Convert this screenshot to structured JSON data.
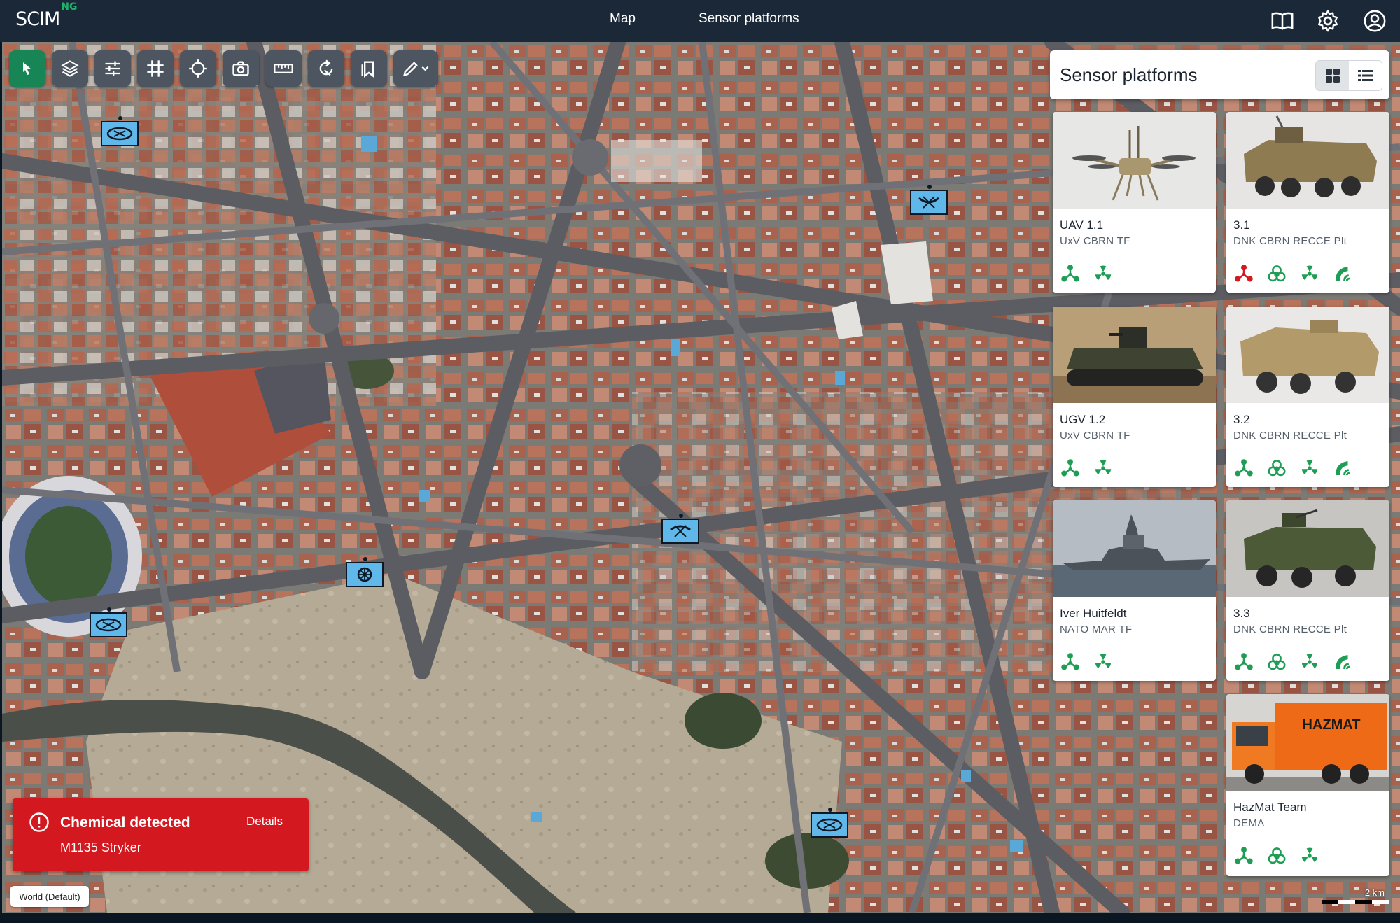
{
  "app": {
    "logo_text": "SCIM",
    "logo_suffix": "NG",
    "accent_color": "#178556"
  },
  "topbar": {
    "nav": [
      {
        "label": "Map"
      },
      {
        "label": "Sensor platforms"
      }
    ],
    "icons": [
      "book-icon",
      "gear-icon",
      "account-icon"
    ]
  },
  "toolbar": {
    "tools": [
      "select-pointer-icon",
      "layers-icon",
      "sliders-icon",
      "grid-icon",
      "crosshair-icon",
      "camera-icon",
      "ruler-icon",
      "rotate-icon",
      "bookmarks-icon",
      "pencil-icon"
    ],
    "active_tool": "select-pointer-icon"
  },
  "panel": {
    "title": "Sensor platforms",
    "view_modes": [
      "grid-view-icon",
      "list-view-icon"
    ],
    "active_view": "grid-view-icon",
    "platforms": [
      {
        "name": "UAV 1.1",
        "unit": "UxV CBRN TF",
        "image": "quadcopter-drone",
        "capabilities": [
          {
            "icon": "chemical-icon",
            "color": "#1e9e54"
          },
          {
            "icon": "radiation-icon",
            "color": "#1e9e54"
          }
        ]
      },
      {
        "name": "3.1",
        "unit": "DNK CBRN RECCE Plt",
        "image": "armored-vehicle-desert",
        "capabilities": [
          {
            "icon": "chemical-icon",
            "color": "#d3181f"
          },
          {
            "icon": "biohazard-icon",
            "color": "#1e9e54"
          },
          {
            "icon": "radiation-icon",
            "color": "#1e9e54"
          },
          {
            "icon": "signal-icon",
            "color": "#1e9e54"
          }
        ]
      },
      {
        "name": "UGV 1.2",
        "unit": "UxV CBRN TF",
        "image": "tracked-ground-robot",
        "capabilities": [
          {
            "icon": "chemical-icon",
            "color": "#1e9e54"
          },
          {
            "icon": "radiation-icon",
            "color": "#1e9e54"
          }
        ]
      },
      {
        "name": "3.2",
        "unit": "DNK CBRN RECCE Plt",
        "image": "armored-vehicle-tan",
        "capabilities": [
          {
            "icon": "chemical-icon",
            "color": "#1e9e54"
          },
          {
            "icon": "biohazard-icon",
            "color": "#1e9e54"
          },
          {
            "icon": "radiation-icon",
            "color": "#1e9e54"
          },
          {
            "icon": "signal-icon",
            "color": "#1e9e54"
          }
        ]
      },
      {
        "name": "Iver Huitfeldt",
        "unit": "NATO MAR TF",
        "image": "frigate-ship",
        "capabilities": [
          {
            "icon": "chemical-icon",
            "color": "#1e9e54"
          },
          {
            "icon": "radiation-icon",
            "color": "#1e9e54"
          }
        ]
      },
      {
        "name": "3.3",
        "unit": "DNK CBRN RECCE Plt",
        "image": "armored-vehicle-green",
        "capabilities": [
          {
            "icon": "chemical-icon",
            "color": "#1e9e54"
          },
          {
            "icon": "biohazard-icon",
            "color": "#1e9e54"
          },
          {
            "icon": "radiation-icon",
            "color": "#1e9e54"
          },
          {
            "icon": "signal-icon",
            "color": "#1e9e54"
          }
        ]
      },
      {
        "name": "HazMat Team",
        "unit": "DEMA",
        "image": "hazmat-truck",
        "image_text": "HAZMAT",
        "capabilities": [
          {
            "icon": "chemical-icon",
            "color": "#1e9e54"
          },
          {
            "icon": "biohazard-icon",
            "color": "#1e9e54"
          },
          {
            "icon": "radiation-icon",
            "color": "#1e9e54"
          }
        ]
      }
    ]
  },
  "alert": {
    "title": "Chemical detected",
    "subtitle": "M1135 Stryker",
    "action": "Details",
    "color": "#d3181f"
  },
  "map": {
    "base_layer": "World (Default)",
    "scale_label": "2 km",
    "markers": [
      "uav-symbol-icon",
      "uav-symbol-icon",
      "uav-symbol-icon",
      "ugv-symbol-icon",
      "wheel-symbol-icon",
      "armor-symbol-icon",
      "armor-symbol-icon"
    ]
  }
}
